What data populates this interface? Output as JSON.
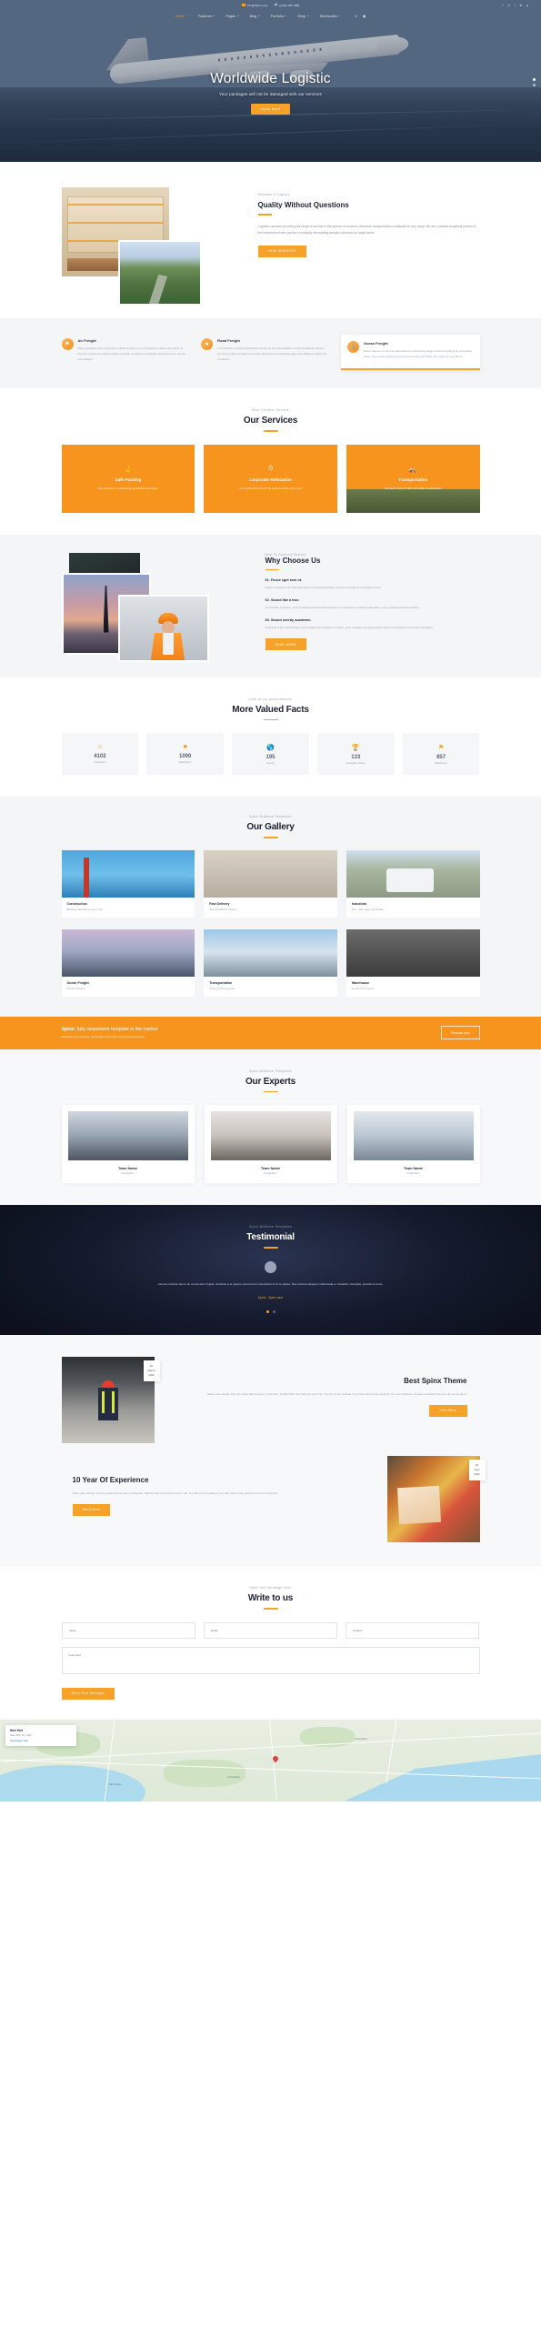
{
  "topbar": {
    "email": "info@Spinx.com",
    "phone": "+(123) 456-7880",
    "social": [
      "f",
      "G",
      "t",
      "in",
      "p"
    ]
  },
  "nav": {
    "items": [
      {
        "label": "Home",
        "caret": true,
        "active": true
      },
      {
        "label": "Features",
        "caret": true,
        "active": false
      },
      {
        "label": "Pages",
        "caret": true,
        "active": false
      },
      {
        "label": "Blog",
        "caret": true,
        "active": false
      },
      {
        "label": "Portfolio",
        "caret": true,
        "active": false
      },
      {
        "label": "Shop",
        "caret": true,
        "active": false
      },
      {
        "label": "Shortcodes",
        "caret": true,
        "active": false
      }
    ],
    "search_icon": "search-icon",
    "cart_icon": "cart-icon"
  },
  "hero": {
    "title": "Worldwide Logistic",
    "subtitle": "Your packages will not be damaged with our services",
    "button": "Learn More"
  },
  "about": {
    "eyebrow": "Welcome to Logistic",
    "title": "Quality Without Questions",
    "body": "Logistics operator providing full range of service in the sphere of customs clearance transportation worldwide for any cargo We are a trusted analytical partner to the financial services and are constantly formulating analytic solutions for large banks.",
    "button": "VIEW SERVICES"
  },
  "features": [
    {
      "icon": "trophy-icon",
      "title": "Air Freight",
      "body": "Many companies face unforeseen situations when it is not possible to deliver the goods on time Our experts are always ready to provide competent consultation and help you to find the best solution."
    },
    {
      "icon": "star-icon",
      "title": "Road Freight",
      "body": "Consolidation And Deconsolidation Centers at our Consolidation or Deconsolidation Centers we aim to reduce storage time at the warehouse by combining cargo from different origins into containers."
    },
    {
      "icon": "anchor-icon",
      "title": "Ocean Freight",
      "body": "Ocean transport is the best alternative for transporting large amounts of freight at competitive prices. We provide shipping services across the world Ship your cargo by sea with us."
    }
  ],
  "services": {
    "eyebrow": "Most Creative Service",
    "title": "Our Services",
    "cards": [
      {
        "icon": "hand-icon",
        "title": "Safe Packing",
        "body": "We can assist on performing operational techniques"
      },
      {
        "icon": "clock-icon",
        "title": "Corporate Relocation",
        "body": "Our teams work around the clock to deliver your need"
      },
      {
        "icon": "truck-icon",
        "title": "Transportation",
        "body": "Complete cargo to fulfil your quality requirements"
      }
    ]
  },
  "why": {
    "eyebrow": "Best To Select A Service",
    "title": "Why Choose Us",
    "points": [
      {
        "title": "01. Fusce eget sem ut.",
        "body": "Ocean transport is the best alternative for transporting large amounts of freight at competitive prices."
      },
      {
        "title": "02. Sound like a true.",
        "body": "Consectetur consequi , enim expedita sed quia nesciunt Dolor sit consectetur consequi quibusdam, enim expedita sed quia nesciunt."
      },
      {
        "title": "03. Sound overtly academic.",
        "body": "Aching for a bit of thrill along in your designs Fernaciatitur consequi , enim expedita sed quia nesciunt Dolor sit consectetur consequi quibusdam."
      }
    ],
    "button": "READ MORE"
  },
  "facts": {
    "eyebrow": "Look at our achievements",
    "title": "More Valued Facts",
    "items": [
      {
        "icon": "smile-icon",
        "value": "4102",
        "label": "Customers"
      },
      {
        "icon": "box-icon",
        "value": "1000",
        "label": "Distributors"
      },
      {
        "icon": "globe-icon",
        "value": "195",
        "label": "Country"
      },
      {
        "icon": "trophy-icon",
        "value": "133",
        "label": "Accolades Collect"
      },
      {
        "icon": "warehouse-icon",
        "value": "857",
        "label": "Warehouse"
      }
    ]
  },
  "gallery": {
    "eyebrow": "Spinx Multiuse Templates",
    "title": "Our Gallery",
    "items": [
      {
        "title": "Construction",
        "sub": "Building materials by sea or rail"
      },
      {
        "title": "Fast Delivery",
        "sub": "Deconsolidation Centers"
      },
      {
        "title": "Industrial",
        "sub": "24/7 - fast, easy and flexible"
      },
      {
        "title": "Ocean Freight",
        "sub": "Ocean transport"
      },
      {
        "title": "Transportation",
        "sub": "storing physical goods"
      },
      {
        "title": "Warehouse",
        "sub": "movement of goods"
      }
    ]
  },
  "cta": {
    "brand": "Spinx:",
    "headline": "fully responsive template in the market",
    "sub": "Exclusive multi purpose lightweight responsive with powerful features",
    "button": "Purchase Now"
  },
  "experts": {
    "eyebrow": "Spinx Multiuse Templates",
    "title": "Our Experts",
    "members": [
      {
        "name": "Team Name",
        "role": "Designation"
      },
      {
        "name": "Team Name",
        "role": "Designation"
      },
      {
        "name": "Team Name",
        "role": "Designation"
      }
    ]
  },
  "testimonial": {
    "eyebrow": "Spinx Multiuse Templates",
    "title": "Testimonial",
    "quote": "Aenean pulvinar lacus nin consectetur Fugiat, similuptu a te aperuu sed utl enim volupratid mi nit et sapien. Nam laoreet aliquam nullamsada a. Curabitur nisl ligula, gravida sit amet.",
    "author": "Spinx -",
    "author_role": "Spinx user"
  },
  "blog": {
    "posts": [
      {
        "day": "10",
        "month": "March",
        "year": "2022",
        "title": "Best Spinx Theme",
        "body": "Raise your design from the dead with an army of Zombie, frightful filler text that just won't die. Try this of the undead if you dare Spinx has solutions for your business. Create a website that you can be proud of.",
        "button": "View More"
      },
      {
        "day": "30",
        "month": "June",
        "year": "2022",
        "title": "10 Year Of Experience",
        "body": "Raise your design from the dead with an army of Zombie, frightful filler text that just won't die. Try this of the undead if you dare Spinx has solutions for your business.",
        "button": "Read More"
      }
    ]
  },
  "contact": {
    "eyebrow": "Send Your Message Here",
    "title": "Write to us",
    "fields": [
      {
        "name": "name-field",
        "placeholder": "Name"
      },
      {
        "name": "email-field",
        "placeholder": "Email"
      },
      {
        "name": "subject-field",
        "placeholder": "Subject"
      }
    ],
    "message_placeholder": "Comment",
    "submit": "Send Your Message"
  },
  "map": {
    "card_title": "New York",
    "card_sub": "New York, NY, USA",
    "card_link": "View larger map",
    "labels": [
      "Long Island",
      "New Jersey",
      "Connecticut"
    ]
  },
  "colors": {
    "accent": "#f6a128",
    "orange": "#f6941e",
    "dark": "#1c2230",
    "muted": "#9aa2ad"
  }
}
